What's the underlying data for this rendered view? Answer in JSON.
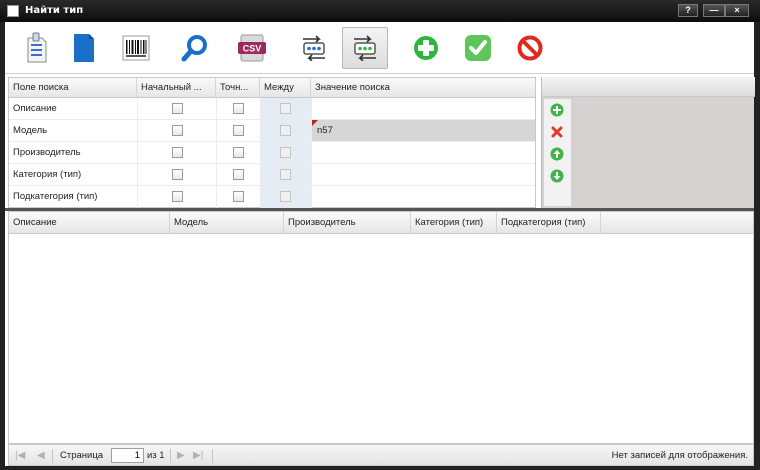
{
  "window": {
    "title": "Найти тип",
    "help_label": "?",
    "minimize_label": "—",
    "close_label": "×"
  },
  "toolbar": {
    "items": [
      {
        "name": "new-document",
        "icon": "document-list-icon"
      },
      {
        "name": "document",
        "icon": "blue-page-icon"
      },
      {
        "name": "barcode",
        "icon": "barcode-icon"
      },
      {
        "name": "search",
        "icon": "magnifier-icon"
      },
      {
        "name": "export-csv",
        "icon": "csv-icon",
        "label": "CSV"
      },
      {
        "name": "swap-1",
        "icon": "swap-arrows-icon"
      },
      {
        "name": "swap-2",
        "icon": "swap-arrows-green-icon",
        "active": true
      },
      {
        "name": "add",
        "icon": "green-plus-icon"
      },
      {
        "name": "confirm",
        "icon": "green-check-icon"
      },
      {
        "name": "cancel",
        "icon": "red-no-icon"
      }
    ]
  },
  "criteria": {
    "columns": [
      "Поле поиска",
      "Начальный ...",
      "Точн...",
      "Между",
      "Значение поиска"
    ],
    "rows": [
      {
        "field": "Описание",
        "start": false,
        "exact": false,
        "between": false,
        "value": ""
      },
      {
        "field": "Модель",
        "start": false,
        "exact": false,
        "between": false,
        "value": "n57",
        "selected": true,
        "dirty": true
      },
      {
        "field": "Производитель",
        "start": false,
        "exact": false,
        "between": false,
        "value": ""
      },
      {
        "field": "Категория (тип)",
        "start": false,
        "exact": false,
        "between": false,
        "value": ""
      },
      {
        "field": "Подкатегория (тип)",
        "start": false,
        "exact": false,
        "between": false,
        "value": ""
      }
    ]
  },
  "side_buttons": [
    {
      "name": "add-criteria",
      "icon": "green-plus-circle-icon"
    },
    {
      "name": "delete-criteria",
      "icon": "red-x-icon"
    },
    {
      "name": "move-up",
      "icon": "green-up-arrow-icon"
    },
    {
      "name": "move-down",
      "icon": "green-down-arrow-icon"
    }
  ],
  "results": {
    "columns": [
      "Описание",
      "Модель",
      "Производитель",
      "Категория (тип)",
      "Подкатегория (тип)"
    ],
    "rows": []
  },
  "pager": {
    "page_label": "Страница",
    "page_value": "1",
    "of_label": "из 1",
    "message": "Нет записей для отображения."
  },
  "colors": {
    "title_bar": "#111111",
    "selected_row": "#d6d6d6",
    "between_column": "#e6ecf4",
    "side_panel": "#d6d2d2",
    "accent_green": "#2db53c",
    "accent_red": "#e02a1e"
  }
}
